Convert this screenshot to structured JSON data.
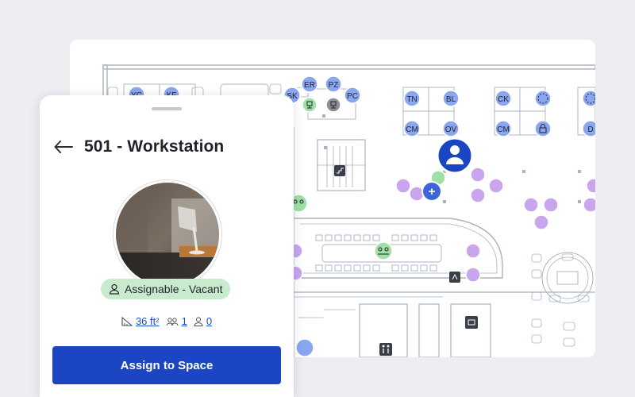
{
  "panel": {
    "title": "501 - Workstation",
    "status_label": "Assignable - Vacant",
    "area_value": "36 ft²",
    "capacity_value": "1",
    "occupants_value": "0",
    "assign_button_label": "Assign to Space"
  },
  "map": {
    "occupant_markers": [
      "YC",
      "KF",
      "ER",
      "PZ",
      "SK",
      "PC",
      "TN",
      "BL",
      "CK",
      "CM",
      "OV",
      "CM",
      "D"
    ],
    "add_label": "+"
  },
  "colors": {
    "accent": "#1c45c4",
    "vacant_badge": "#c9ebcd",
    "assigned_marker": "#8aa6ee",
    "vacant_marker": "#9ee0a6",
    "meeting_marker": "#c9a5ee",
    "map_wall": "#a9b2c0"
  }
}
